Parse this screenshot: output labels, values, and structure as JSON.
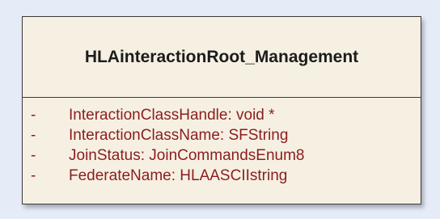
{
  "class": {
    "name": "HLAinteractionRoot_Management",
    "attributes": [
      {
        "visibility": "-",
        "text": "InteractionClassHandle:  void *"
      },
      {
        "visibility": "-",
        "text": "InteractionClassName:  SFString"
      },
      {
        "visibility": "-",
        "text": "JoinStatus:  JoinCommandsEnum8"
      },
      {
        "visibility": "-",
        "text": "FederateName:  HLAASCIIstring"
      }
    ]
  },
  "colors": {
    "canvas_background": "#e6ebf8",
    "class_fill": "#f6f0e3",
    "border": "#3a3a3a",
    "attribute_text": "#8b1d1d",
    "class_name_text": "#1c1c1c"
  }
}
